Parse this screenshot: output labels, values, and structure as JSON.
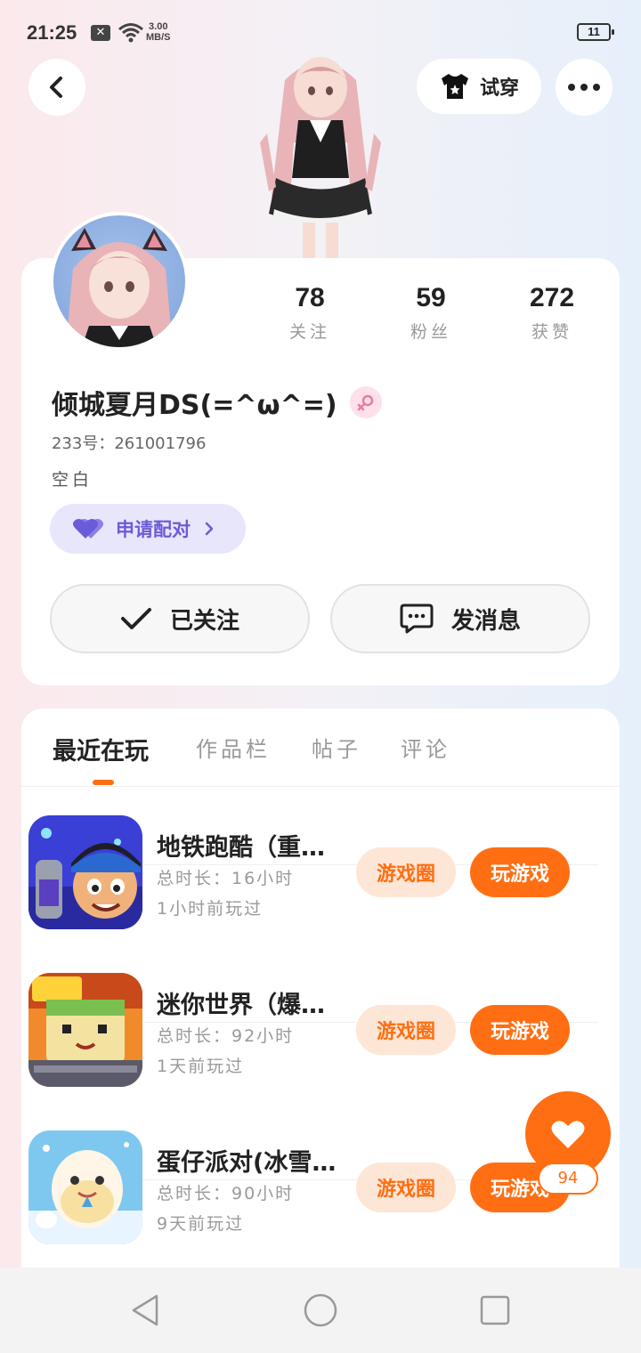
{
  "status_bar": {
    "time": "21:25",
    "notification_badge": "✕",
    "speed_value": "3.00",
    "speed_unit": "MB/S",
    "battery": "11"
  },
  "header": {
    "tryon_label": "试穿"
  },
  "profile": {
    "stats": [
      {
        "value": "78",
        "label": "关注"
      },
      {
        "value": "59",
        "label": "粉丝"
      },
      {
        "value": "272",
        "label": "获赞"
      }
    ],
    "username": "倾城夏月DS(=^ω^=)",
    "uid": "233号：261001796",
    "bio": "空白",
    "pair_label": "申请配对",
    "follow_label": "已关注",
    "message_label": "发消息"
  },
  "tabs": [
    {
      "label": "最近在玩",
      "active": true
    },
    {
      "label": "作品栏",
      "active": false
    },
    {
      "label": "帖子",
      "active": false
    },
    {
      "label": "评论",
      "active": false
    }
  ],
  "games": [
    {
      "title": "地铁跑酷（重…",
      "playtime": "总时长：16小时",
      "last_played": "1小时前玩过",
      "circle_label": "游戏圈",
      "play_label": "玩游戏"
    },
    {
      "title": "迷你世界（爆…",
      "playtime": "总时长：92小时",
      "last_played": "1天前玩过",
      "circle_label": "游戏圈",
      "play_label": "玩游戏"
    },
    {
      "title": "蛋仔派对(冰雪…",
      "playtime": "总时长：90小时",
      "last_played": "9天前玩过",
      "circle_label": "游戏圈",
      "play_label": "玩游戏"
    }
  ],
  "like_fab": {
    "count": "94"
  },
  "colors": {
    "accent": "#ff6e12",
    "pair_text": "#6a5cd8",
    "pair_bg": "#e8e6fb"
  }
}
